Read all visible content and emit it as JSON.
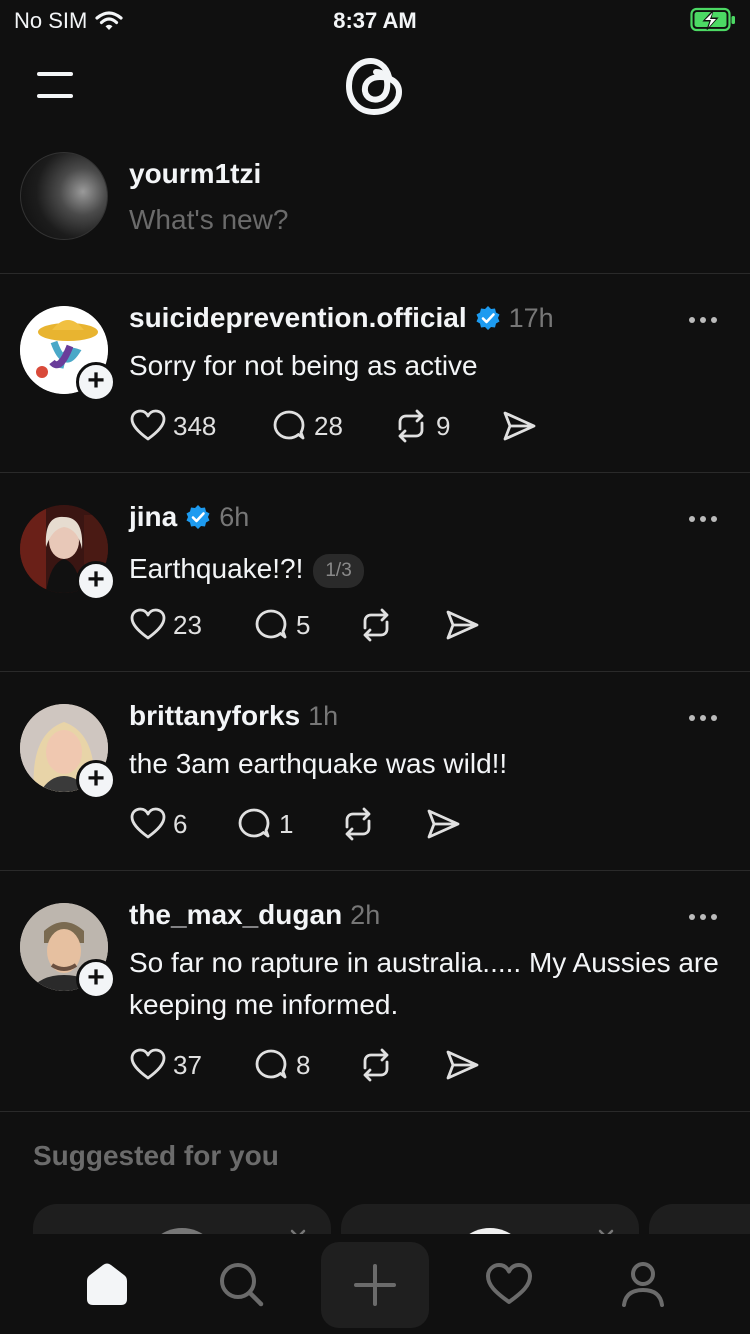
{
  "status_bar": {
    "carrier": "No SIM",
    "time": "8:37 AM"
  },
  "composer": {
    "username": "yourm1tzi",
    "placeholder": "What's new?"
  },
  "posts": [
    {
      "username": "suicideprevention.official",
      "verified": true,
      "time": "17h",
      "text": "Sorry for not being as active",
      "likes": "348",
      "replies": "28",
      "reposts": "9"
    },
    {
      "username": "jina",
      "verified": true,
      "time": "6h",
      "text": "Earthquake!?!",
      "page_indicator": "1/3",
      "likes": "23",
      "replies": "5",
      "reposts": ""
    },
    {
      "username": "brittanyforks",
      "verified": false,
      "time": "1h",
      "text": "the 3am earthquake was wild!!",
      "likes": "6",
      "replies": "1",
      "reposts": ""
    },
    {
      "username": "the_max_dugan",
      "verified": false,
      "time": "2h",
      "text": "So far no rapture in australia..... My Aussies are keeping me informed.",
      "likes": "37",
      "replies": "8",
      "reposts": ""
    }
  ],
  "suggested": {
    "title": "Suggested for you"
  },
  "tabs": [
    "home-icon",
    "search-icon",
    "compose-icon",
    "heart-icon",
    "profile-icon"
  ],
  "colors": {
    "background": "#101010",
    "verified": "#1d9bf0",
    "battery": "#4cd964",
    "muted": "#777777"
  }
}
